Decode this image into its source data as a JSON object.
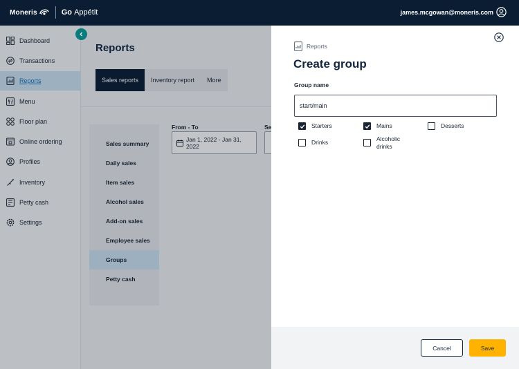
{
  "header": {
    "brand": "Moneris",
    "app_name_bold": "Go",
    "app_name": "Appétit",
    "user_email": "james.mcgowan@moneris.com"
  },
  "sidebar": {
    "items": [
      {
        "label": "Dashboard",
        "icon": "dashboard-icon"
      },
      {
        "label": "Transactions",
        "icon": "transactions-icon"
      },
      {
        "label": "Reports",
        "icon": "reports-icon",
        "active": true
      },
      {
        "label": "Menu",
        "icon": "menu-icon"
      },
      {
        "label": "Floor plan",
        "icon": "floor-plan-icon"
      },
      {
        "label": "Online ordering",
        "icon": "online-ordering-icon"
      },
      {
        "label": "Profiles",
        "icon": "profiles-icon"
      },
      {
        "label": "Inventory",
        "icon": "inventory-icon"
      },
      {
        "label": "Petty cash",
        "icon": "petty-cash-icon"
      },
      {
        "label": "Settings",
        "icon": "settings-icon"
      }
    ]
  },
  "main": {
    "title": "Reports",
    "tabs": [
      {
        "label": "Sales reports",
        "active": true
      },
      {
        "label": "Inventory report"
      },
      {
        "label": "More"
      }
    ],
    "report_types": [
      "Sales summary",
      "Daily sales",
      "Item sales",
      "Alcohol sales",
      "Add-on sales",
      "Employee sales",
      "Groups",
      "Petty cash"
    ],
    "active_report": "Groups",
    "filters": {
      "date_label": "From - To",
      "date_value": "Jan 1, 2022 - Jan 31, 2022",
      "second_label": "Se"
    }
  },
  "panel": {
    "breadcrumb": "Reports",
    "title": "Create group",
    "field_label": "Group name",
    "group_name_value": "start/main",
    "options": [
      {
        "label": "Starters",
        "checked": true
      },
      {
        "label": "Mains",
        "checked": true
      },
      {
        "label": "Desserts",
        "checked": false
      },
      {
        "label": "Drinks",
        "checked": false
      },
      {
        "label": "Alcoholic drinks",
        "checked": false
      }
    ],
    "cancel_label": "Cancel",
    "save_label": "Save"
  },
  "colors": {
    "header_bg": "#0a1d33",
    "accent": "#ffb300",
    "active_nav": "#cde4f3",
    "link": "#1670b7"
  }
}
